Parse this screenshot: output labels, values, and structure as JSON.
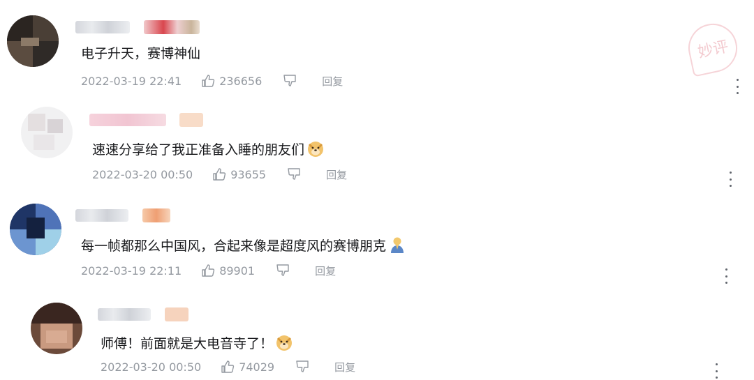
{
  "watermark": "妙评",
  "comments": [
    {
      "text": "电子升天，赛博神仙",
      "time": "2022-03-19 22:41",
      "likes": "236656",
      "reply_label": "回复",
      "emoji": ""
    },
    {
      "text": "速速分享给了我正准备入睡的朋友们",
      "time": "2022-03-20 00:50",
      "likes": "93655",
      "reply_label": "回复",
      "emoji": "doge-emoji"
    },
    {
      "text": "每一帧都那么中国风，合起来像是超度风的赛博朋克",
      "time": "2022-03-19 22:11",
      "likes": "89901",
      "reply_label": "回复",
      "emoji": "person-praying-emoji"
    },
    {
      "text": "师傅！前面就是大电音寺了！",
      "time": "2022-03-20 00:50",
      "likes": "74029",
      "reply_label": "回复",
      "emoji": "doge-emoji"
    }
  ]
}
